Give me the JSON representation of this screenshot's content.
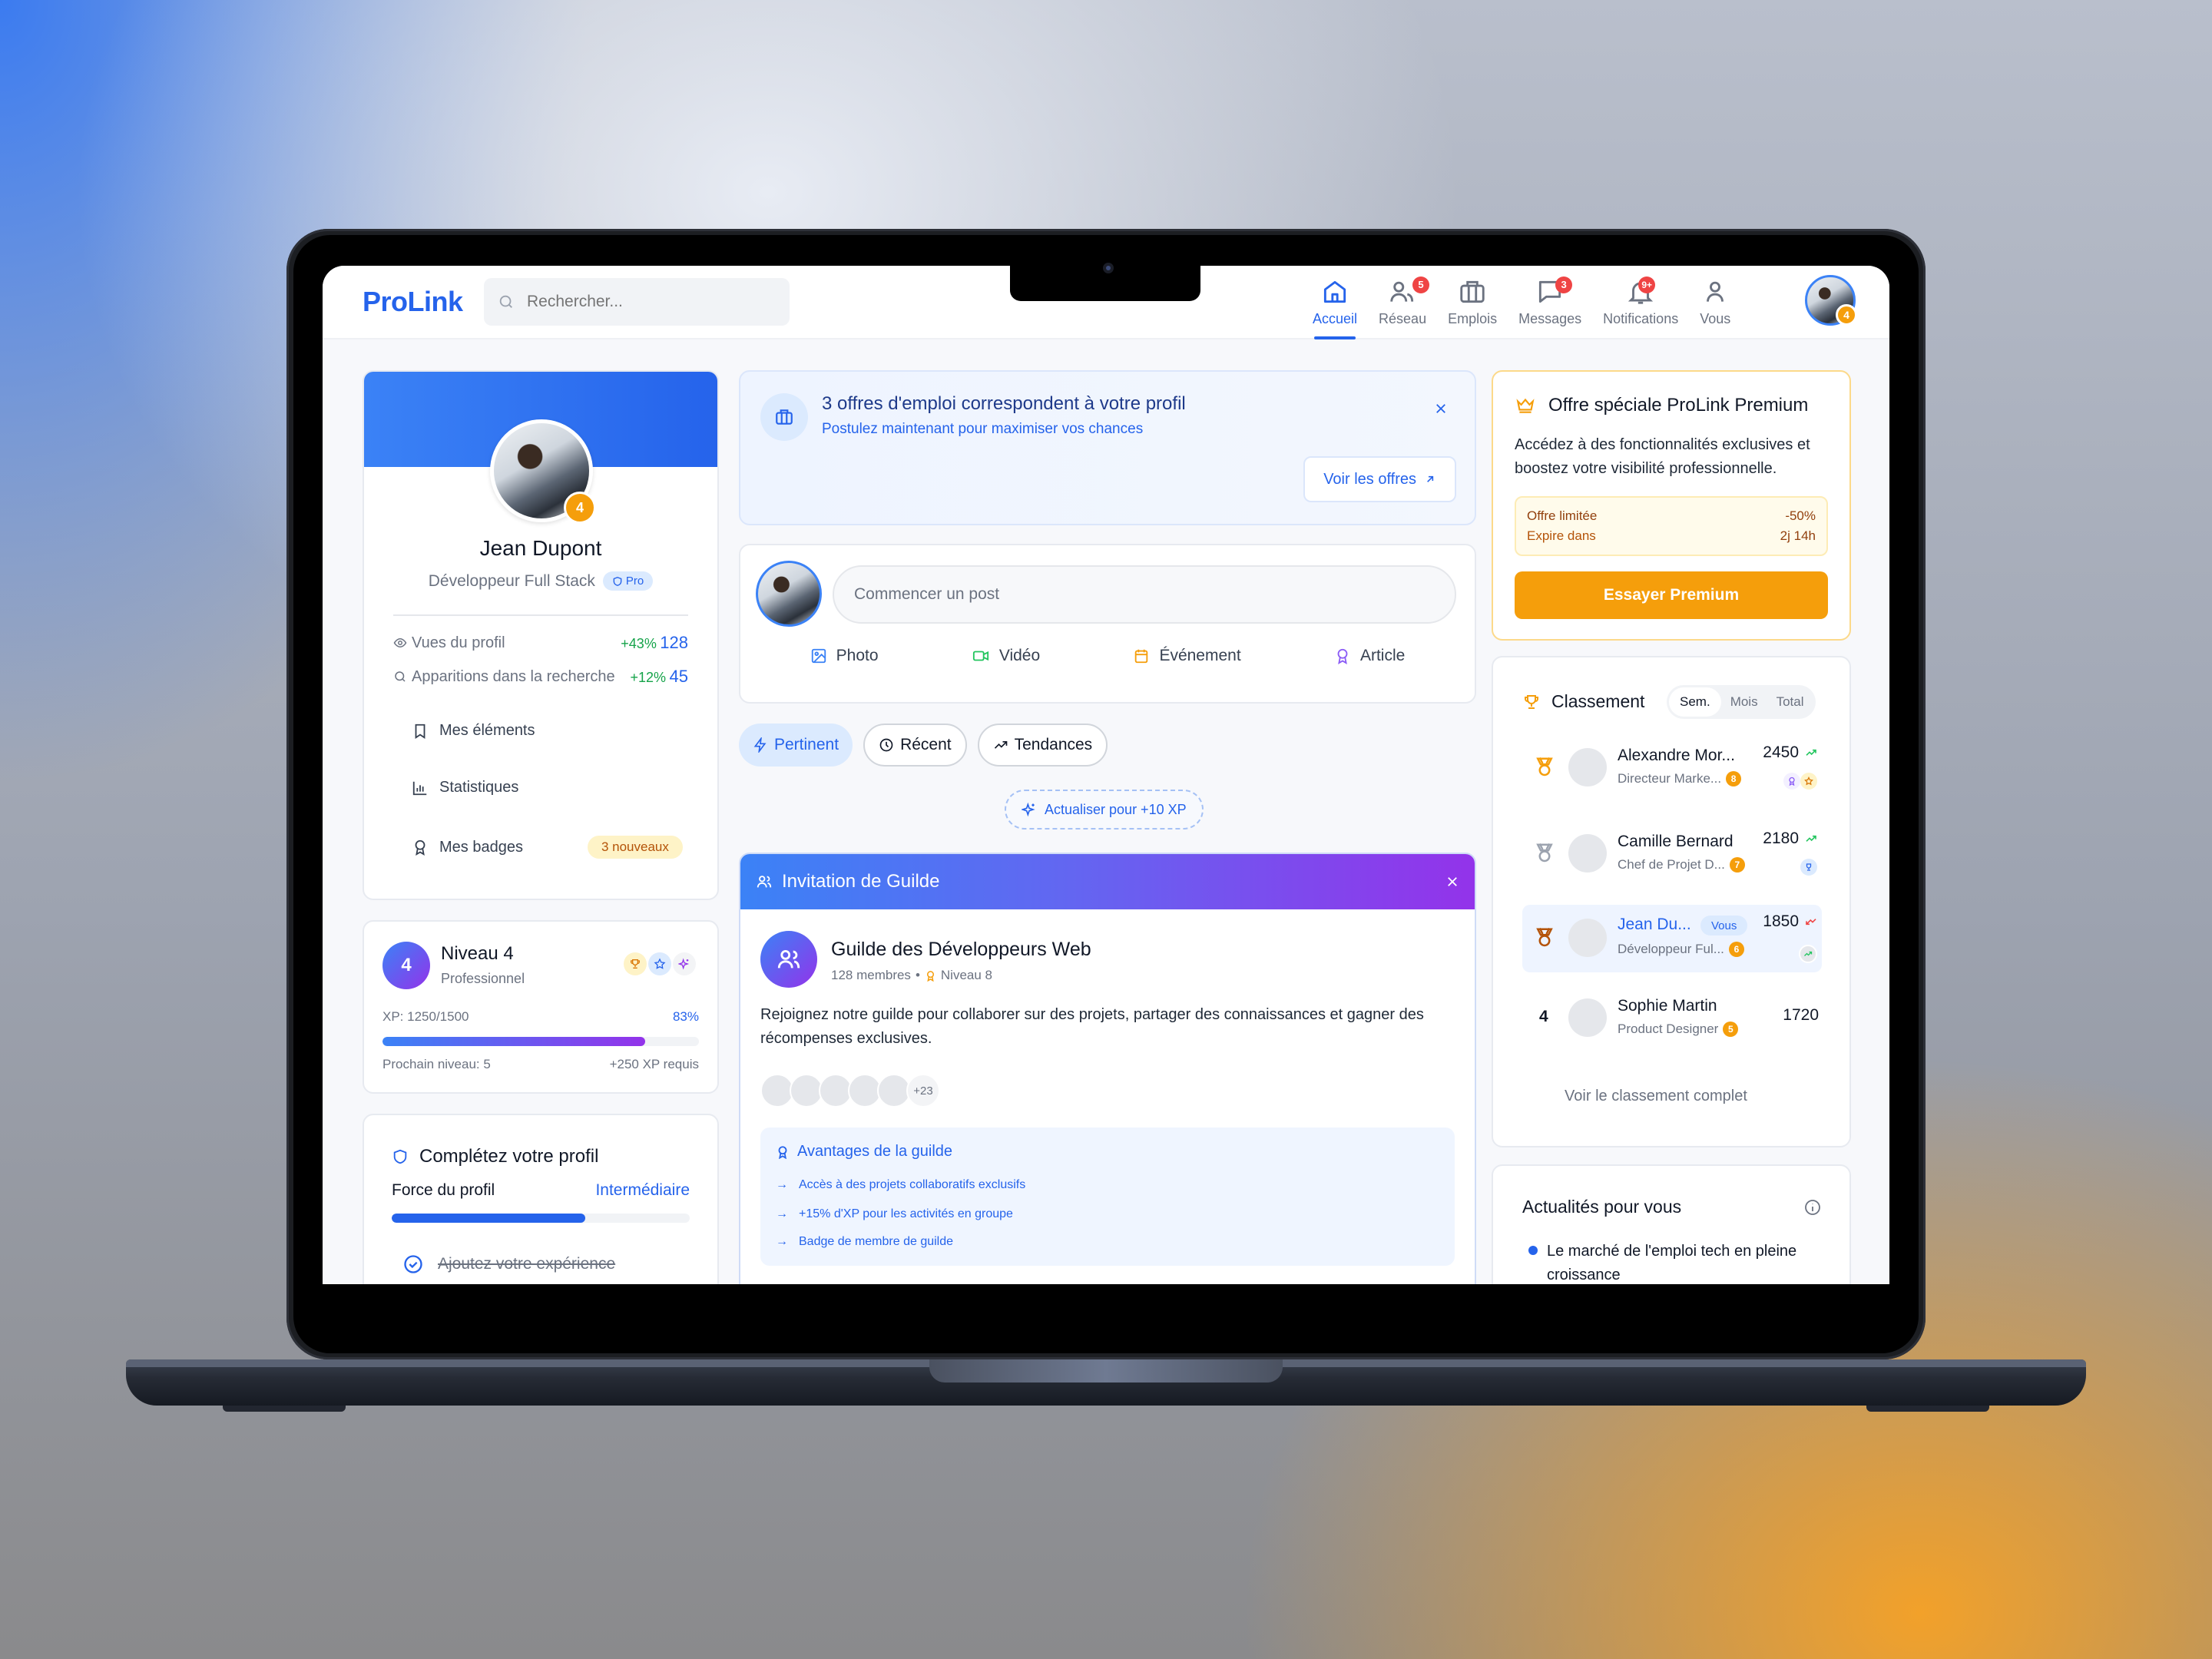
{
  "app": {
    "name": "ProLink"
  },
  "search": {
    "placeholder": "Rechercher..."
  },
  "nav": [
    {
      "label": "Accueil",
      "icon": "home-icon",
      "active": true,
      "badge": null
    },
    {
      "label": "Réseau",
      "icon": "users-icon",
      "badge": "5"
    },
    {
      "label": "Emplois",
      "icon": "briefcase-icon",
      "badge": null
    },
    {
      "label": "Messages",
      "icon": "message-icon",
      "badge": "3"
    },
    {
      "label": "Notifications",
      "icon": "bell-icon",
      "badge": "9+"
    },
    {
      "label": "Vous",
      "icon": "user-icon",
      "badge": null
    }
  ],
  "user": {
    "level_badge": "4"
  },
  "profile": {
    "name": "Jean Dupont",
    "title": "Développeur Full Stack",
    "pro_badge": "Pro",
    "level_badge": "4",
    "stats": [
      {
        "label": "Vues du profil",
        "change": "+43%",
        "value": "128",
        "icon": "eye-icon"
      },
      {
        "label": "Apparitions dans la recherche",
        "change": "+12%",
        "value": "45",
        "icon": "search-icon"
      }
    ],
    "links": [
      {
        "label": "Mes éléments",
        "icon": "bookmark-icon"
      },
      {
        "label": "Statistiques",
        "icon": "bar-chart-icon"
      },
      {
        "label": "Mes badges",
        "icon": "award-icon",
        "badge": "3 nouveaux"
      }
    ]
  },
  "level": {
    "number": "4",
    "title": "Niveau 4",
    "subtitle": "Professionnel",
    "xp_label": "XP: 1250/1500",
    "xp_percent_label": "83%",
    "xp_fraction": 0.83,
    "next_label": "Prochain niveau: 5",
    "required_label": "+250 XP requis"
  },
  "complete": {
    "title": "Complétez votre profil",
    "strength_label": "Force du profil",
    "strength_value": "Intermédiaire",
    "strength_fraction": 0.65,
    "tasks": [
      {
        "label": "Ajoutez votre expérience",
        "done": true
      }
    ]
  },
  "job_alert": {
    "title": "3 offres d'emploi correspondent à votre profil",
    "subtitle": "Postulez maintenant pour maximiser vos chances",
    "button": "Voir les offres"
  },
  "composer": {
    "placeholder": "Commencer un post",
    "actions": [
      {
        "label": "Photo",
        "icon": "image-icon",
        "color": "#3b82f6"
      },
      {
        "label": "Vidéo",
        "icon": "video-icon",
        "color": "#22c55e"
      },
      {
        "label": "Événement",
        "icon": "calendar-icon",
        "color": "#f59e0b"
      },
      {
        "label": "Article",
        "icon": "award-icon",
        "color": "#8b5cf6"
      }
    ]
  },
  "filters": [
    {
      "label": "Pertinent",
      "icon": "zap-icon",
      "active": true
    },
    {
      "label": "Récent",
      "icon": "clock-icon"
    },
    {
      "label": "Tendances",
      "icon": "trending-up-icon"
    }
  ],
  "refresh": {
    "label": "Actualiser pour +10 XP"
  },
  "guild": {
    "header": "Invitation de Guilde",
    "name": "Guilde des Développeurs Web",
    "members": "128 membres",
    "level": "Niveau 8",
    "description": "Rejoignez notre guilde pour collaborer sur des projets, partager des connaissances et gagner des récompenses exclusives.",
    "more_members": "+23",
    "benefits_title": "Avantages de la guilde",
    "benefits": [
      "Accès à des projets collaboratifs exclusifs",
      "+15% d'XP pour les activités en groupe",
      "Badge de membre de guilde"
    ]
  },
  "premium": {
    "title": "Offre spéciale ProLink Premium",
    "description": "Accédez à des fonctionnalités exclusives et boostez votre visibilité professionnelle.",
    "offer_label": "Offre limitée",
    "offer_value": "-50%",
    "expire_label": "Expire dans",
    "expire_value": "2j 14h",
    "button": "Essayer Premium"
  },
  "leaderboard": {
    "title": "Classement",
    "tabs": [
      "Sem.",
      "Mois",
      "Total"
    ],
    "active_tab": 0,
    "rows": [
      {
        "rank": "1",
        "medal": "gold",
        "name": "Alexandre Mor...",
        "role": "Directeur Marke...",
        "level": "8",
        "score": "2450",
        "trend": "up"
      },
      {
        "rank": "2",
        "medal": "silver",
        "name": "Camille Bernard",
        "role": "Chef de Projet D...",
        "level": "7",
        "score": "2180",
        "trend": "up"
      },
      {
        "rank": "3",
        "medal": "bronze",
        "name": "Jean Du...",
        "role": "Développeur Ful...",
        "level": "6",
        "score": "1850",
        "trend": "down",
        "you": "Vous"
      },
      {
        "rank": "4",
        "medal": null,
        "name": "Sophie Martin",
        "role": "Product Designer",
        "level": "5",
        "score": "1720",
        "trend": null
      }
    ],
    "see_all": "Voir le classement complet"
  },
  "news": {
    "title": "Actualités pour vous",
    "items": [
      "Le marché de l'emploi tech en pleine croissance"
    ]
  },
  "colors": {
    "primary": "#2563eb",
    "accent_orange": "#f59e0b",
    "purple": "#9333ea",
    "danger": "#ef4444",
    "success": "#22c55e"
  }
}
